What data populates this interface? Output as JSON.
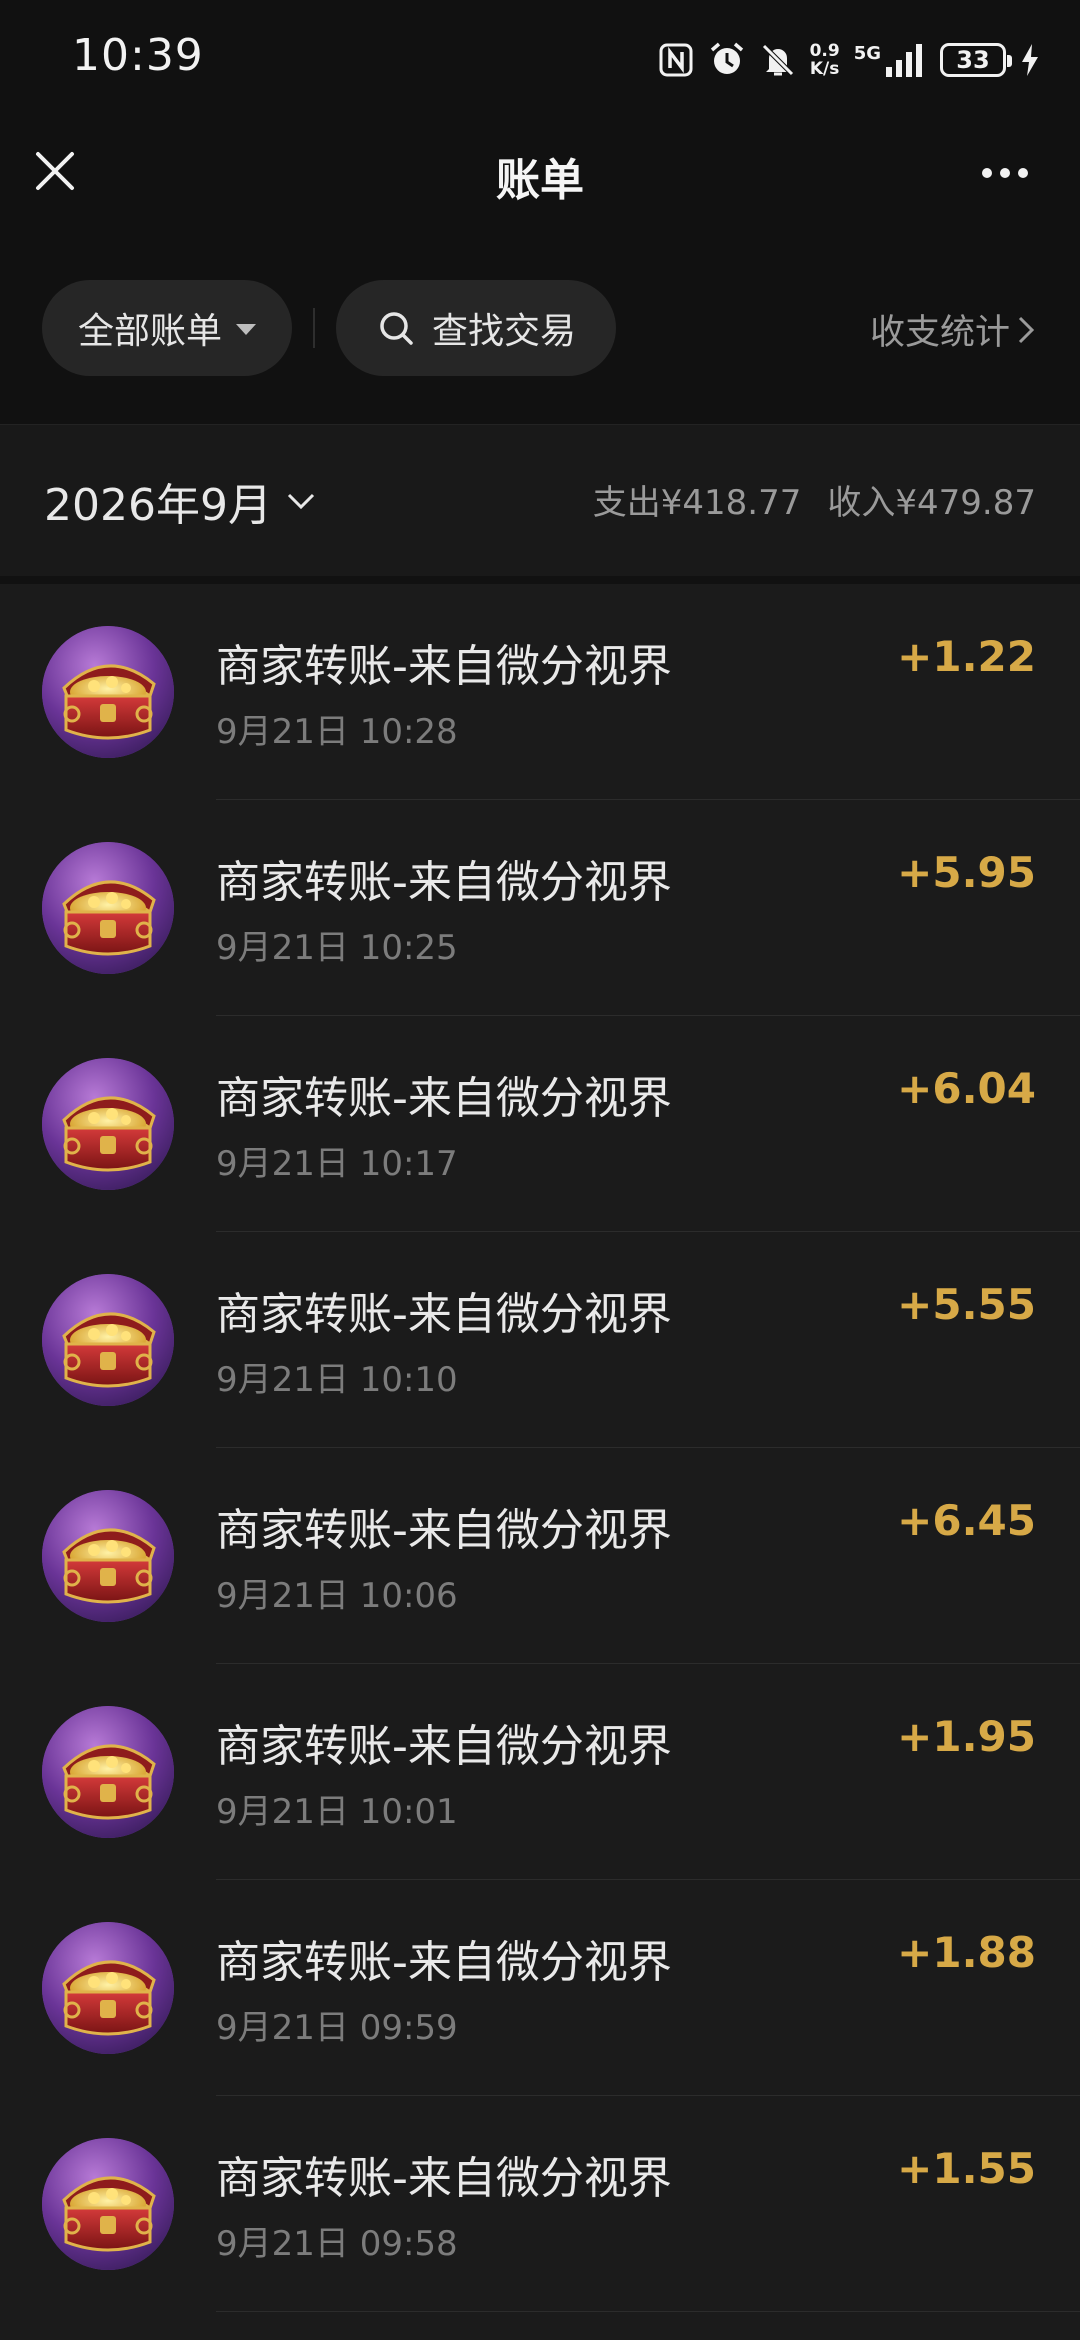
{
  "status_bar": {
    "time": "10:39",
    "net_speed_top": "0.9",
    "net_speed_bottom": "K/s",
    "network": "5G",
    "battery": "33",
    "icons": [
      "nfc-icon",
      "alarm-icon",
      "mute-icon",
      "signal-icon",
      "charging-icon"
    ]
  },
  "header": {
    "title": "账单",
    "close_icon": "close-icon",
    "more_icon": "more-icon"
  },
  "filters": {
    "all_bills": "全部账单",
    "search": "查找交易",
    "stats": "收支统计"
  },
  "month": {
    "label": "2026年9月",
    "expense": "支出¥418.77",
    "income": "收入¥479.87"
  },
  "transactions": [
    {
      "title": "商家转账-来自微分视界",
      "time": "9月21日 10:28",
      "amount": "+1.22"
    },
    {
      "title": "商家转账-来自微分视界",
      "time": "9月21日 10:25",
      "amount": "+5.95"
    },
    {
      "title": "商家转账-来自微分视界",
      "time": "9月21日 10:17",
      "amount": "+6.04"
    },
    {
      "title": "商家转账-来自微分视界",
      "time": "9月21日 10:10",
      "amount": "+5.55"
    },
    {
      "title": "商家转账-来自微分视界",
      "time": "9月21日 10:06",
      "amount": "+6.45"
    },
    {
      "title": "商家转账-来自微分视界",
      "time": "9月21日 10:01",
      "amount": "+1.95"
    },
    {
      "title": "商家转账-来自微分视界",
      "time": "9月21日 09:59",
      "amount": "+1.88"
    },
    {
      "title": "商家转账-来自微分视界",
      "time": "9月21日 09:58",
      "amount": "+1.55"
    }
  ],
  "colors": {
    "background": "#111111",
    "list_background": "#1b1b1b",
    "income_amount": "#d7a947",
    "secondary_text": "#9a9a9a"
  }
}
